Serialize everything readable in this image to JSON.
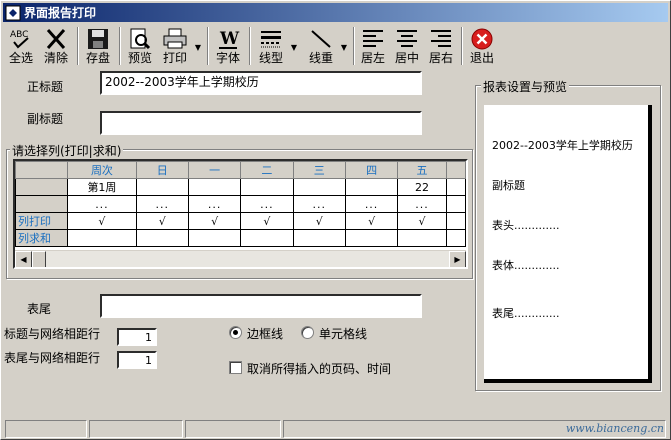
{
  "window": {
    "title": "界面报告打印"
  },
  "toolbar": {
    "select_all": "全选",
    "clear": "清除",
    "save": "存盘",
    "preview": "预览",
    "print": "打印",
    "font": "字体",
    "line_type": "线型",
    "line_weight": "线重",
    "align_left": "居左",
    "align_center": "居中",
    "align_right": "居右",
    "exit": "退出"
  },
  "form": {
    "main_title_label": "正标题",
    "main_title_value": "2002--2003学年上学期校历",
    "sub_title_label": "副标题",
    "sub_title_value": "",
    "columns_group_title": "请选择列(打印|求和)",
    "footer_label": "表尾",
    "footer_value": "",
    "title_grid_spacing_label": "标题与网络相距行",
    "title_grid_spacing_value": "1",
    "footer_grid_spacing_label": "表尾与网络相距行",
    "footer_grid_spacing_value": "1",
    "border_line_label": "边框线",
    "cell_line_label": "单元格线",
    "cancel_insert_label": "取消所得插入的页码、时间"
  },
  "grid": {
    "headers": [
      "",
      "周次",
      "日",
      "一",
      "二",
      "三",
      "四",
      "五",
      ""
    ],
    "row1": [
      "",
      "第1周",
      "",
      "",
      "",
      "",
      "",
      "22",
      ""
    ],
    "row2": [
      "",
      "...",
      "...",
      "...",
      "...",
      "...",
      "...",
      "...",
      ""
    ],
    "row_print": [
      "列打印",
      "√",
      "√",
      "√",
      "√",
      "√",
      "√",
      "√",
      ""
    ],
    "row_sum": [
      "列求和",
      "",
      "",
      "",
      "",
      "",
      "",
      "",
      ""
    ]
  },
  "preview": {
    "group_title": "报表设置与预览",
    "title_line": "2002--2003学年上学期校历",
    "subtitle_line": "副标题",
    "header_line": "表头.............",
    "body_line": "表体.............",
    "footer_line": "表尾............."
  },
  "watermark": "www.bianceng.cn",
  "colors": {
    "title_start": "#0a246a",
    "title_end": "#a6caf0",
    "grid_header_text": "#1a6fc0",
    "exit_red": "#d81e1e"
  }
}
